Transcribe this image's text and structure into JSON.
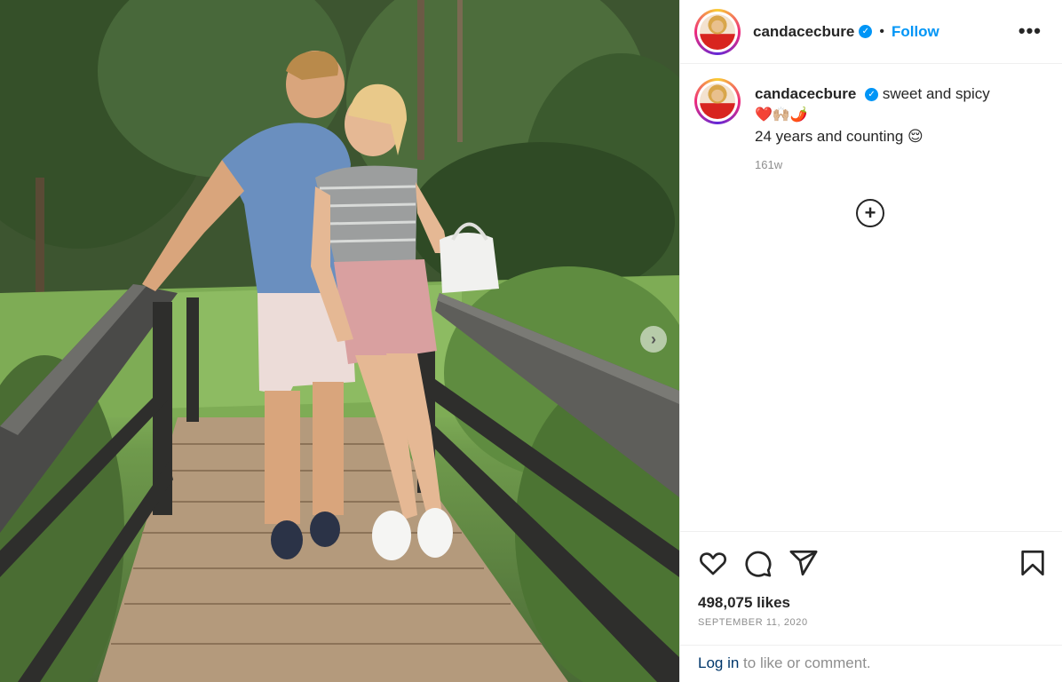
{
  "post": {
    "username": "candacecbure",
    "verified_symbol": "✓",
    "dot": "•",
    "follow_label": "Follow",
    "more_label": "•••",
    "caption_text": "sweet and spicy",
    "caption_emoji": "❤️🙌🏼🌶️",
    "caption_line2": "24 years and counting",
    "caption_line2_emoji": "😌",
    "age": "161w",
    "load_more_label": "+",
    "carousel_next": "›",
    "likes": "498,075 likes",
    "date": "SEPTEMBER 11, 2020",
    "login_link": "Log in",
    "login_suffix": " to like or comment."
  },
  "icons": {
    "like": "heart-icon",
    "comment": "comment-icon",
    "share": "share-icon",
    "save": "bookmark-icon"
  },
  "colors": {
    "accent": "#0095f6",
    "text": "#262626",
    "muted": "#8e8e8e",
    "link": "#00376b"
  }
}
